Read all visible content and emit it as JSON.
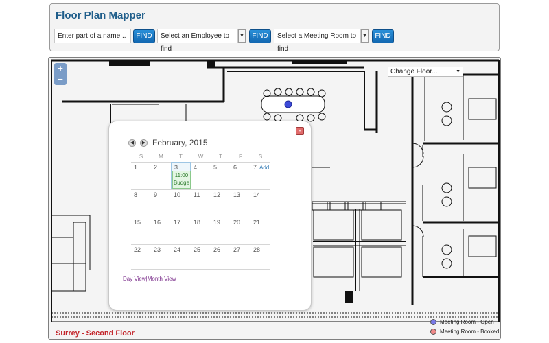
{
  "app": {
    "title": "Floor Plan Mapper"
  },
  "search": {
    "name_placeholder": "Enter part of a name...",
    "find_label": "FIND",
    "employee_select": "Select an Employee to find",
    "room_select": "Select a Meeting Room to find"
  },
  "map": {
    "zoom_in": "+",
    "zoom_out": "−",
    "floor_select": "Change Floor...",
    "floor_label": "Surrey - Second Floor",
    "legend": [
      {
        "label": "Meeting Room - Open",
        "color": "#7b7be8"
      },
      {
        "label": "Meeting Room - Booked",
        "color": "#f08a8a"
      }
    ]
  },
  "calendar": {
    "month_label": "February, 2015",
    "weekdays": [
      "S",
      "M",
      "T",
      "W",
      "T",
      "F",
      "S"
    ],
    "weeks": [
      [
        "1",
        "2",
        "3",
        "4",
        "5",
        "6",
        "7"
      ],
      [
        "8",
        "9",
        "10",
        "11",
        "12",
        "13",
        "14"
      ],
      [
        "15",
        "16",
        "17",
        "18",
        "19",
        "20",
        "21"
      ],
      [
        "22",
        "23",
        "24",
        "25",
        "26",
        "27",
        "28"
      ]
    ],
    "today": "3",
    "event": {
      "time": "11:00",
      "title": "Budge"
    },
    "add_link": "Add",
    "view_day": "Day View",
    "view_sep": "|",
    "view_month": "Month View",
    "close_glyph": "×",
    "prev_glyph": "◀",
    "next_glyph": "▶"
  },
  "icons": {
    "dropdown": "▼"
  }
}
